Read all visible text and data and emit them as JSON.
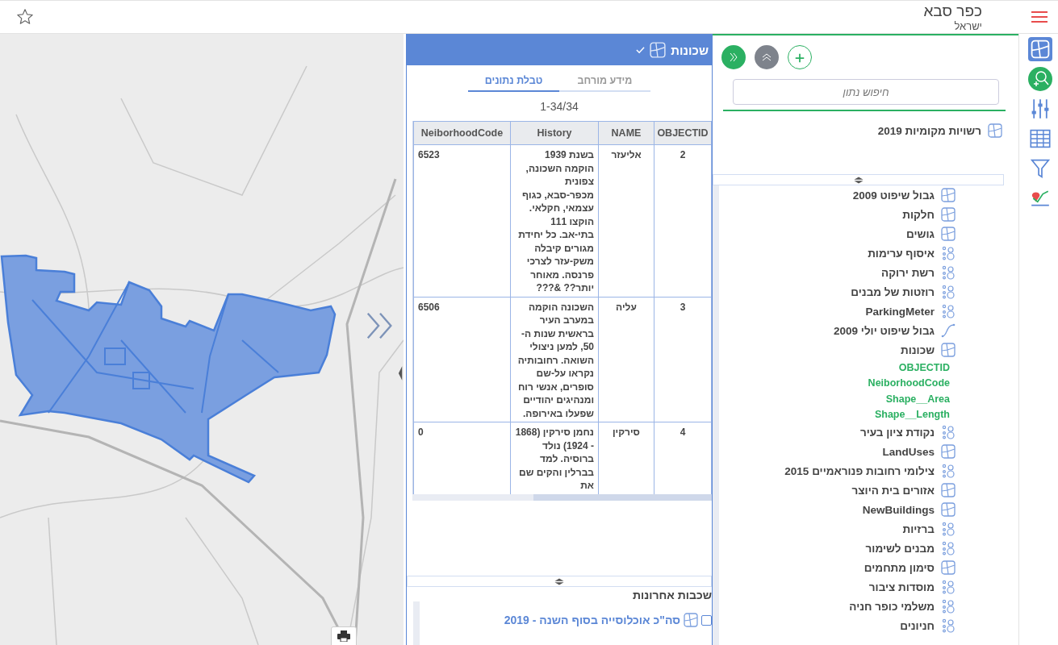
{
  "header": {
    "title": "כפר סבא",
    "subtitle": "ישראל"
  },
  "data_panel": {
    "title": "שכונות",
    "tabs": [
      {
        "label": "מידע מורחב",
        "selected": false
      },
      {
        "label": "טבלת נתונים",
        "selected": true
      }
    ],
    "count": "1-34/34",
    "table": {
      "columns": [
        "OBJECTID",
        "NAME",
        "History",
        "NeiborhoodCode"
      ],
      "rows": [
        [
          "2",
          "אליעזר",
          "בשנת 1939 הוקמה השכונה, צפונית מכפר-סבא, כגוף עצמאי, חקלאי. הוקצו 111 בתי-אב. כל יחידת מגורים קיבלה משק-עזר לצרכי פרנסה. מאוחר יותר?? &???",
          "6523"
        ],
        [
          "3",
          "עליה",
          "השכונה הוקמה במערב העיר בראשית שנות ה- 50, למען ניצולי השואה. רחובותיה נקראו על-שם סופרים, אנשי רוח ומנהיגים יהודיים שפעלו באירופה.",
          "6506"
        ],
        [
          "4",
          "סירקין",
          "נחמן סירקין (1868 - 1924) נולד ברוסיה. למד בברלין והקים שם את",
          "0"
        ]
      ]
    },
    "recent": {
      "title": "שכבות אחרונות",
      "items": [
        {
          "label": "סה\"כ אוכלוסייה בסוף השנה - 2019",
          "kind": "polygon",
          "checked": false
        }
      ]
    }
  },
  "layers_panel": {
    "search": {
      "placeholder": "חיפוש נתון"
    },
    "pinned": [
      {
        "label": "רשויות מקומיות 2019",
        "kind": "polygon"
      }
    ],
    "items": [
      {
        "label": "גבול שיפוט 2009",
        "kind": "polygon"
      },
      {
        "label": "חלקות",
        "kind": "polygon"
      },
      {
        "label": "גושים",
        "kind": "polygon"
      },
      {
        "label": "איסוף ערימות",
        "kind": "point"
      },
      {
        "label": "רשת ירוקה",
        "kind": "point"
      },
      {
        "label": "רוזטות של מבנים",
        "kind": "point"
      },
      {
        "label": "ParkingMeter",
        "kind": "point"
      },
      {
        "label": "גבול שיפוט יולי 2009",
        "kind": "line"
      },
      {
        "label": "שכונות",
        "kind": "polygon",
        "children": [
          {
            "label": "OBJECTID"
          },
          {
            "label": "NeiborhoodCode"
          },
          {
            "label": "Shape__Area"
          },
          {
            "label": "Shape__Length"
          }
        ]
      },
      {
        "label": "נקודת ציון בעיר",
        "kind": "point"
      },
      {
        "label": "LandUses",
        "kind": "polygon"
      },
      {
        "label": "צילומי רחובות פנוראמיים 2015",
        "kind": "point"
      },
      {
        "label": "אזורים בית היוצר",
        "kind": "polygon"
      },
      {
        "label": "NewBuildings",
        "kind": "polygon"
      },
      {
        "label": "ברזיות",
        "kind": "point"
      },
      {
        "label": "מבנים לשימור",
        "kind": "point"
      },
      {
        "label": "סימון מתחמים",
        "kind": "polygon"
      },
      {
        "label": "מוסדות ציבור",
        "kind": "point"
      },
      {
        "label": "משלמי כופר חניה",
        "kind": "point"
      },
      {
        "label": "חניונים",
        "kind": "point"
      }
    ]
  },
  "rail": [
    {
      "kind": "layers",
      "selected": true
    },
    {
      "kind": "search",
      "selected": false
    },
    {
      "kind": "sliders",
      "selected": false
    },
    {
      "kind": "table",
      "selected": false
    },
    {
      "kind": "filter",
      "selected": false
    },
    {
      "kind": "chart",
      "selected": false
    }
  ]
}
